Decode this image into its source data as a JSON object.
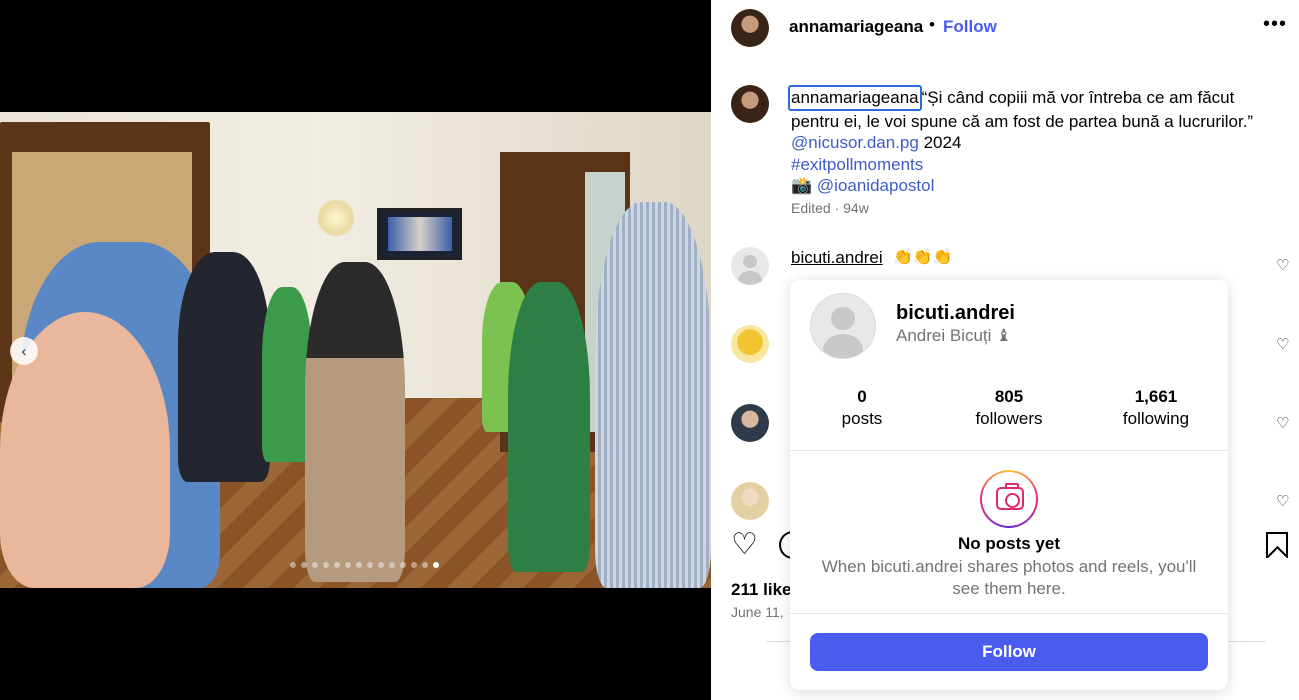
{
  "post": {
    "author": "annamariageana",
    "follow_label": "Follow",
    "separator": "•",
    "more_label": "•••",
    "caption_text": "“Și când copiii mă vor întreba ce am făcut pentru ei, le voi spune că am fost de partea bună a lucrurilor.”",
    "caption_mention": "@nicusor.dan.pg",
    "caption_year": "2024",
    "caption_hashtag": "#exitpollmoments",
    "caption_camera": "📸",
    "caption_photo_credit": "@ioanidapostol",
    "edited": "Edited · 94w",
    "likes": "211 likes",
    "date": "June 11,",
    "carousel_prev": "‹",
    "carousel_total": 14,
    "carousel_active": 13
  },
  "comments": [
    {
      "user": "bicuti.andrei",
      "text": "👏👏👏",
      "heart": "♡"
    },
    {
      "heart": "♡"
    },
    {
      "heart": "♡"
    },
    {
      "heart": "♡"
    }
  ],
  "actions": {
    "like_icon": "♡"
  },
  "hover_card": {
    "username": "bicuti.andrei",
    "full_name": "Andrei Bicuți ♝",
    "stats": [
      {
        "value": "0",
        "label": "posts"
      },
      {
        "value": "805",
        "label": "followers"
      },
      {
        "value": "1,661",
        "label": "following"
      }
    ],
    "empty_title": "No posts yet",
    "empty_message": "When bicuti.andrei shares photos and reels, you'll see them here.",
    "follow_label": "Follow"
  },
  "colors": {
    "accent": "#4a5cf0",
    "link": "#3e5cc6",
    "muted": "#737373"
  }
}
